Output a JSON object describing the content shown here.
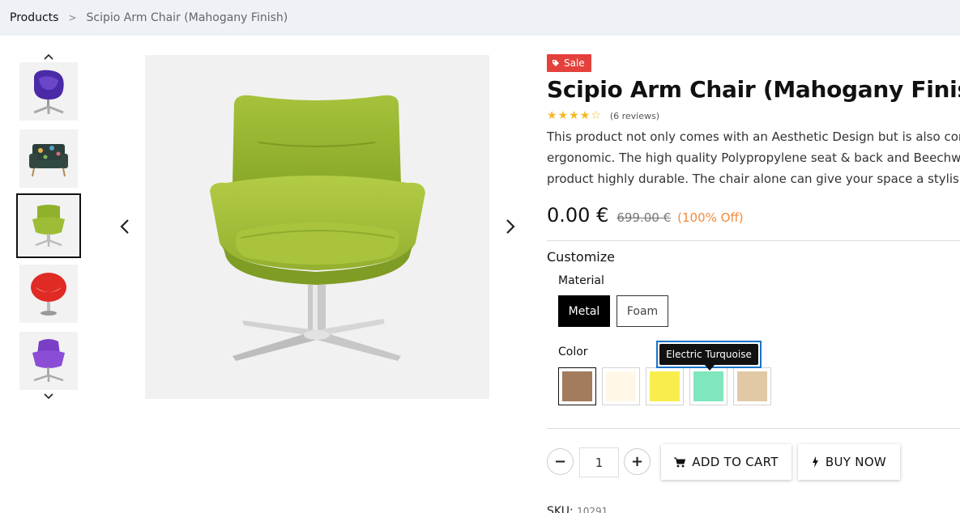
{
  "breadcrumb": {
    "root": "Products",
    "separator": ">",
    "current": "Scipio Arm Chair (Mahogany Finish)"
  },
  "gallery": {
    "thumbnails": [
      {
        "name": "purple-egg-chair",
        "active": false
      },
      {
        "name": "floral-armchair",
        "active": false
      },
      {
        "name": "green-lounge-chair",
        "active": true
      },
      {
        "name": "red-pod-chair",
        "active": false
      },
      {
        "name": "purple-swan-chair",
        "active": false
      }
    ]
  },
  "product": {
    "badge": "Sale",
    "title": "Scipio Arm Chair (Mahogany Finish)",
    "rating": 4,
    "rating_max": 5,
    "reviews": "(6 reviews)",
    "description": [
      "This product not only comes with an Aesthetic Design but is also comfortable and",
      "ergonomic. The high quality Polypropylene seat & back and Beechwood legs make this",
      "product highly durable. The chair alone can give your space a stylish edge."
    ],
    "price_now": "0.00 €",
    "price_old": "699.00 €",
    "discount": "(100% Off)"
  },
  "customize": {
    "title": "Customize",
    "material_label": "Material",
    "materials": [
      {
        "label": "Metal",
        "selected": true
      },
      {
        "label": "Foam",
        "selected": false
      }
    ],
    "color_label": "Color",
    "colors": [
      {
        "hex": "#a27c5d",
        "selected": true
      },
      {
        "hex": "#fff8e8",
        "selected": false
      },
      {
        "hex": "#f9ed4d",
        "selected": false
      },
      {
        "hex": "#7fe6bd",
        "selected": false
      },
      {
        "hex": "#e1c9a5",
        "selected": false
      }
    ],
    "tooltip": "Electric Turquoise"
  },
  "cart": {
    "quantity": "1",
    "minus": "−",
    "plus": "+",
    "add_to_cart": "ADD TO CART",
    "buy_now": "BUY NOW"
  },
  "sku": {
    "label": "SKU:",
    "value": "10291"
  },
  "colors": {
    "sale": "#e4413d",
    "discount": "#f08a3c",
    "star": "#f5b921",
    "tooltip_border": "#1a73c9"
  }
}
